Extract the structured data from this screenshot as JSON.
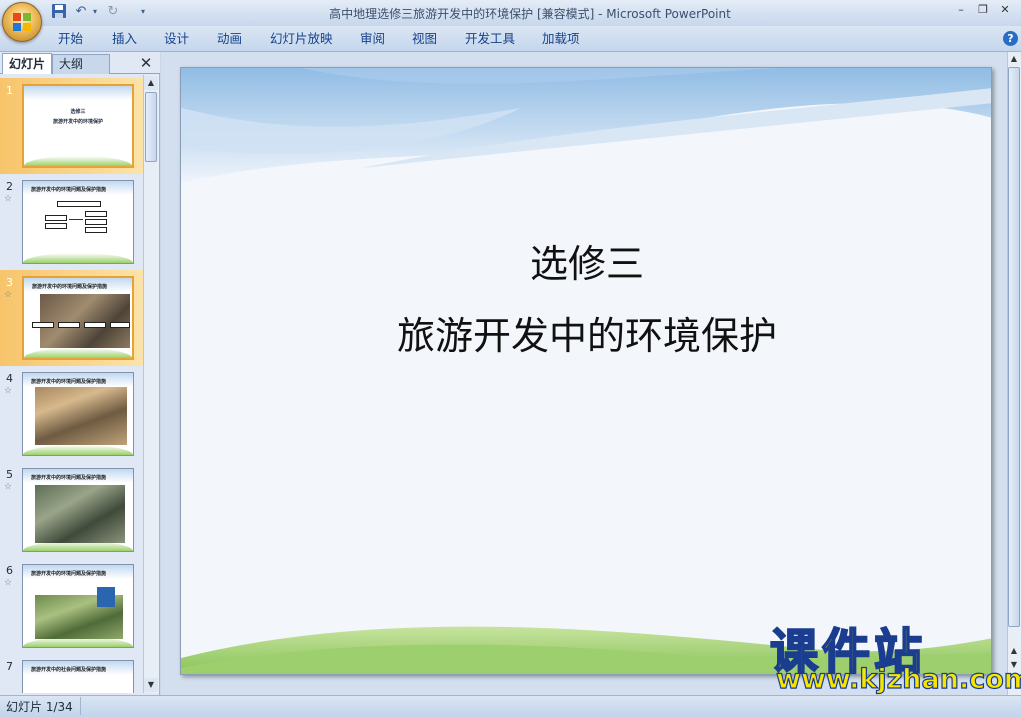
{
  "window": {
    "title": "高中地理选修三旅游开发中的环境保护 [兼容模式] - Microsoft PowerPoint",
    "minimize": "–",
    "restore": "❐",
    "close": "✕"
  },
  "quick_access": {
    "save_icon": "save-icon",
    "undo_icon": "undo-icon",
    "redo_icon": "redo-icon",
    "customize_icon": "dropdown-icon"
  },
  "ribbon": {
    "tabs": [
      "开始",
      "插入",
      "设计",
      "动画",
      "幻灯片放映",
      "审阅",
      "视图",
      "开发工具",
      "加载项"
    ],
    "help": "?"
  },
  "pane": {
    "tab_slides": "幻灯片",
    "tab_outline": "大纲",
    "close": "✕",
    "thumbnails": [
      {
        "num": "1",
        "selected": true,
        "lines": [
          "选修三",
          "旅游开发中的环境保护"
        ]
      },
      {
        "num": "2",
        "anim": "☆",
        "title": "旅游开发中的环境问题及保护措施"
      },
      {
        "num": "3",
        "anim": "☆",
        "title": "旅游开发中的环境问题及保护措施"
      },
      {
        "num": "4",
        "anim": "☆",
        "title": "旅游开发中的环境问题及保护措施"
      },
      {
        "num": "5",
        "anim": "☆",
        "title": "旅游开发中的环境问题及保护措施"
      },
      {
        "num": "6",
        "anim": "☆",
        "title": "旅游开发中的环境问题及保护措施"
      },
      {
        "num": "7",
        "title": "旅游开发中的社会问题及保护措施"
      }
    ]
  },
  "slide": {
    "title": "选修三",
    "subtitle": "旅游开发中的环境保护"
  },
  "status": {
    "slide_counter": "幻灯片 1/34"
  },
  "watermark": {
    "text": "课件站",
    "url": "www.kjzhan.com"
  },
  "colors": {
    "selection": "#f7c46a",
    "ribbon_text": "#15428b",
    "watermark_fill": "#f4e600",
    "watermark_stroke": "#1a3d8f"
  }
}
